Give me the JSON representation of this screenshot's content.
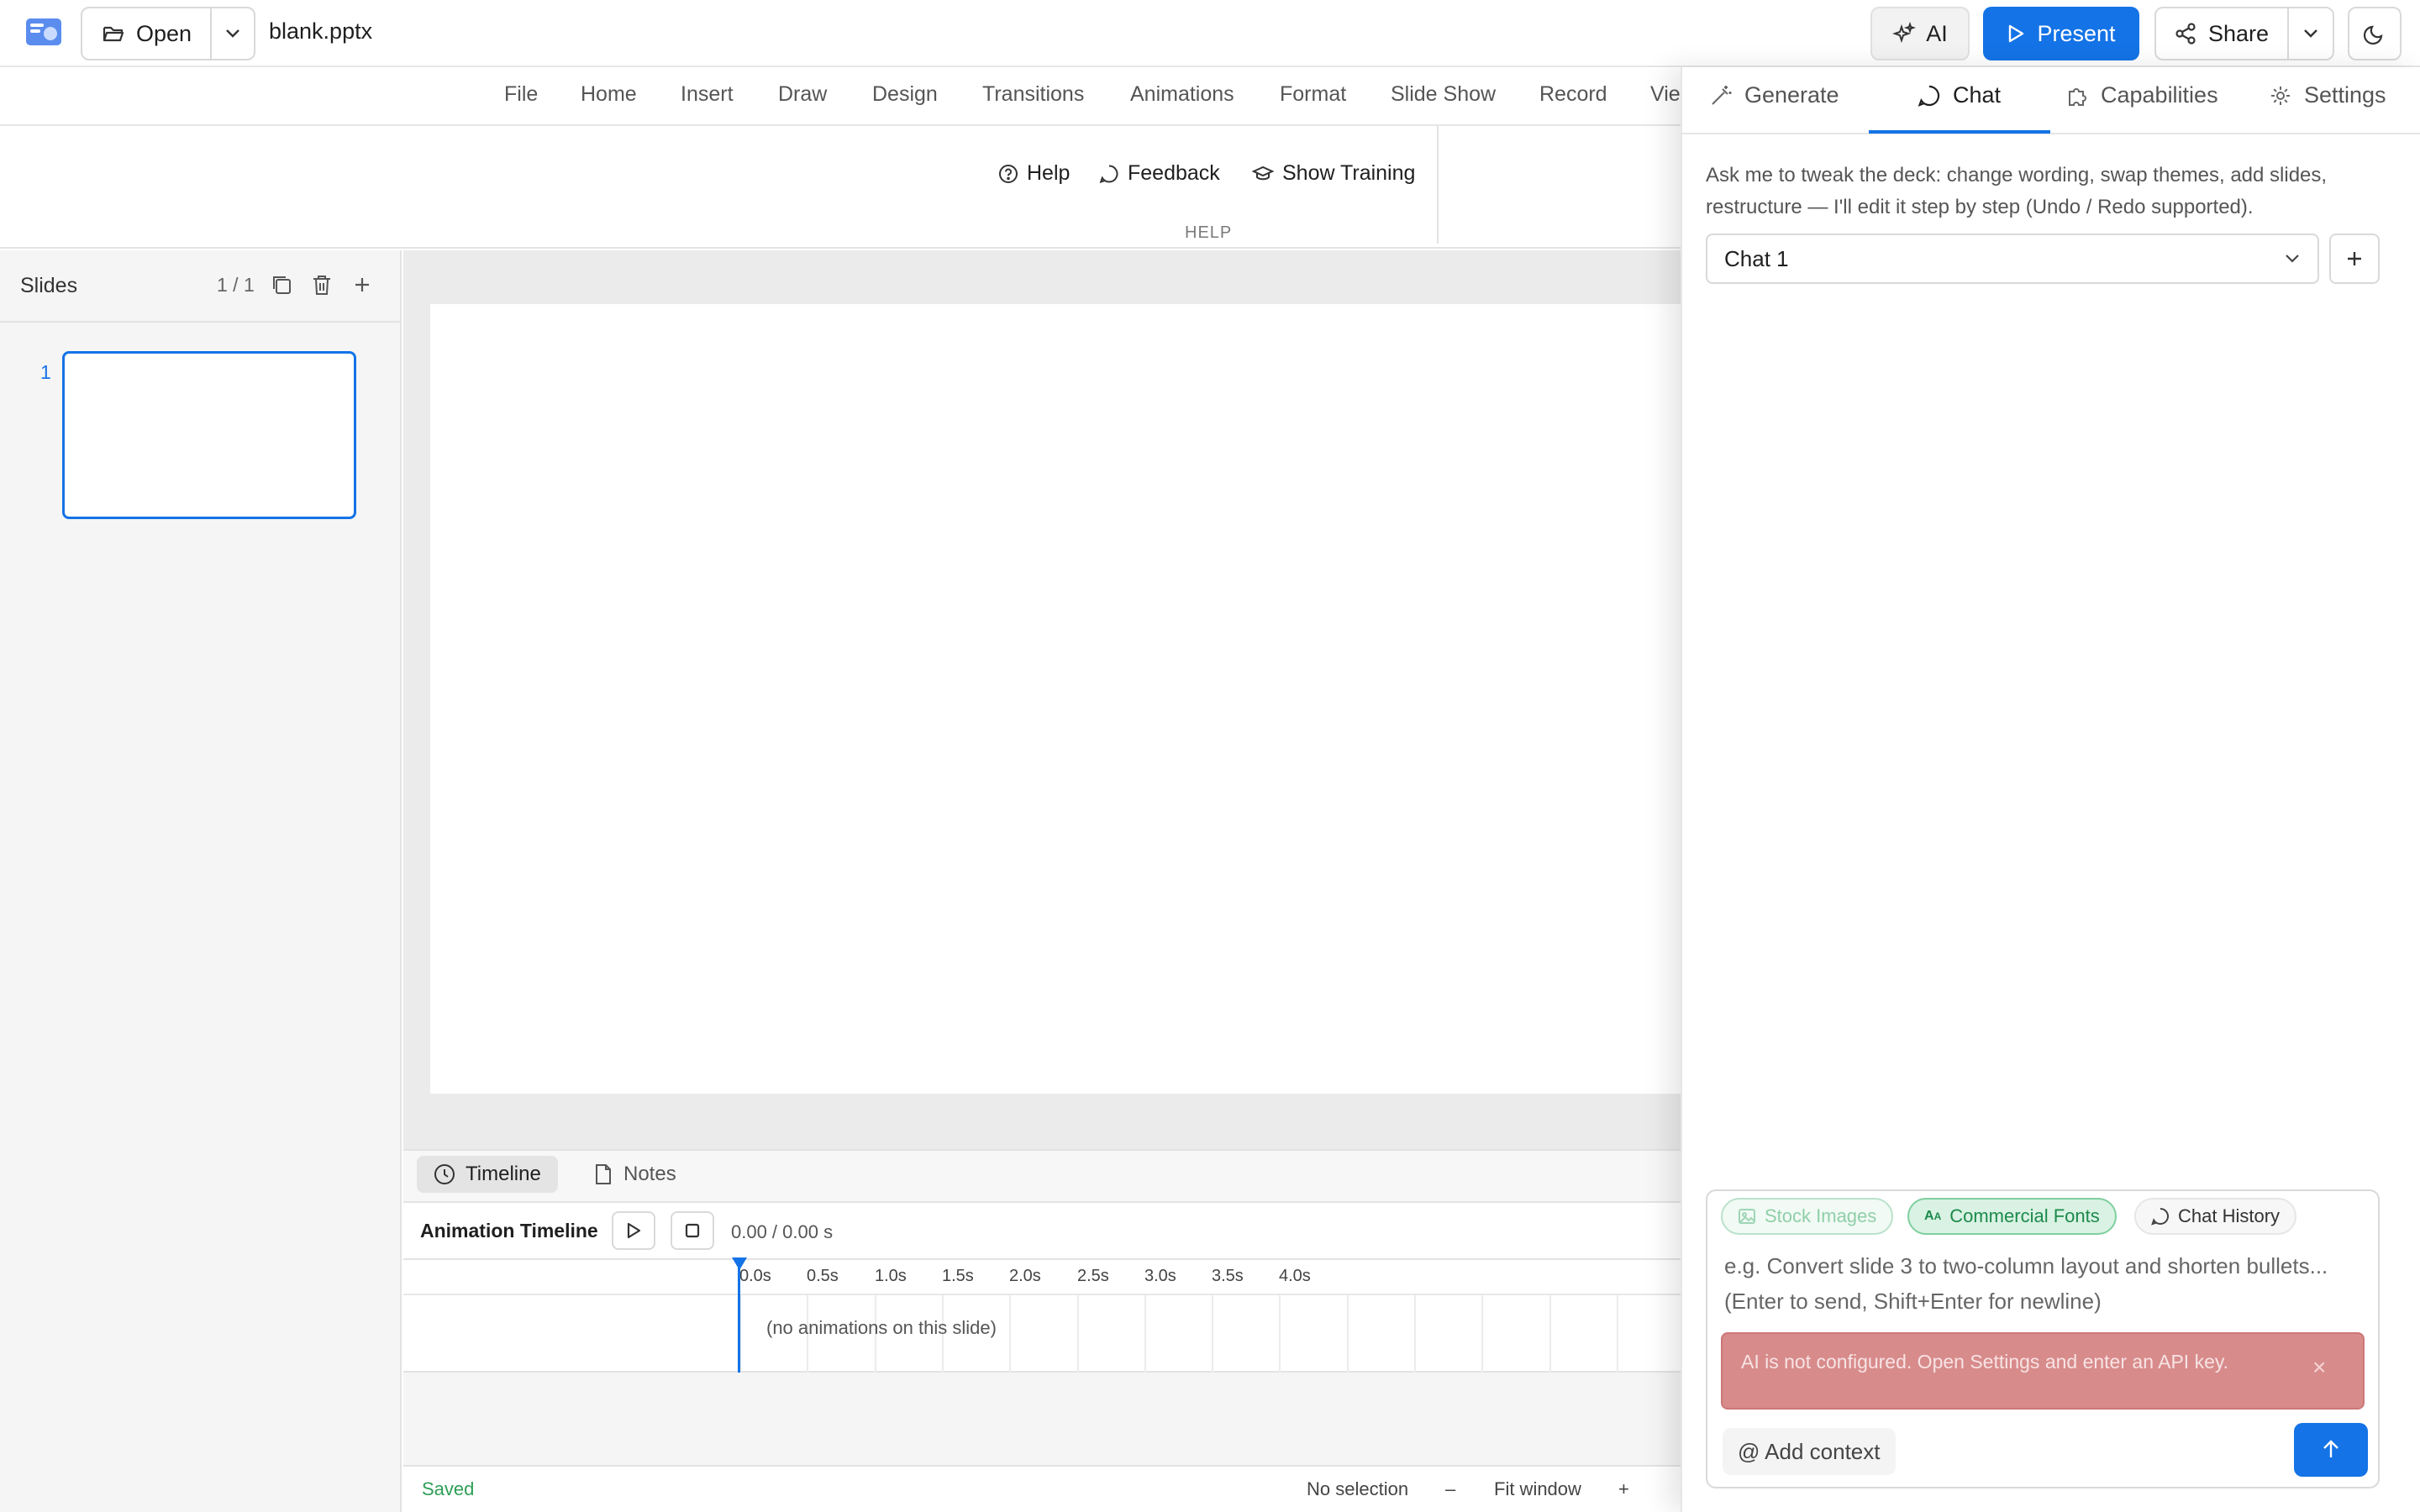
{
  "topbar": {
    "open_label": "Open",
    "file_name": "blank.pptx",
    "ai_label": "AI",
    "present_label": "Present",
    "share_label": "Share"
  },
  "ribbon": {
    "tabs": [
      "File",
      "Home",
      "Insert",
      "Draw",
      "Design",
      "Transitions",
      "Animations",
      "Format",
      "Slide Show",
      "Record",
      "Vie"
    ],
    "help_items": [
      "Help",
      "Feedback",
      "Show Training"
    ],
    "group_label": "HELP"
  },
  "slides_panel": {
    "title": "Slides",
    "count": "1 / 1",
    "slide_numbers": [
      "1"
    ]
  },
  "timeline": {
    "tabs": [
      "Timeline",
      "Notes"
    ],
    "title": "Animation Timeline",
    "time": "0.00 / 0.00 s",
    "ticks": [
      "0.0s",
      "0.5s",
      "1.0s",
      "1.5s",
      "2.0s",
      "2.5s",
      "3.0s",
      "3.5s",
      "4.0s"
    ],
    "empty_message": "(no animations on this slide)"
  },
  "statusbar": {
    "saved": "Saved",
    "selection": "No selection",
    "zoom_minus": "–",
    "zoom_label": "Fit window",
    "zoom_plus": "+"
  },
  "ai_panel": {
    "tabs": [
      "Generate",
      "Chat",
      "Capabilities",
      "Settings"
    ],
    "active_tab": "Chat",
    "intro": "Ask me to tweak the deck: change wording, swap themes, add slides, restructure — I'll edit it step by step (Undo / Redo supported).",
    "chat_select": "Chat 1",
    "chips": [
      "Stock Images",
      "Commercial Fonts",
      "Chat History"
    ],
    "placeholder": "e.g. Convert slide 3 to two-column layout and shorten bullets... (Enter to send, Shift+Enter for newline)",
    "error": "AI is not configured. Open Settings and enter an API key.",
    "error_close": "×",
    "add_context": "@ Add context"
  },
  "colors": {
    "accent": "#1473e6",
    "saved_green": "#2e9e55",
    "error_bg": "#d88b8b",
    "fonts_chip": "#1c8a4b"
  }
}
